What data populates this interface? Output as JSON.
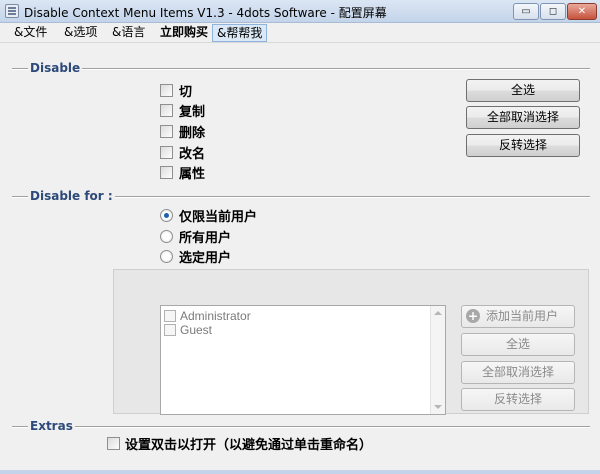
{
  "window": {
    "title": "Disable Context Menu Items V1.3 - 4dots Software - 配置屏幕",
    "minimize": "▭",
    "maximize": "◻",
    "close": "✕"
  },
  "menu": {
    "file": "&文件",
    "options": "&选项",
    "language": "&语言",
    "buy_now": "立即购买",
    "help": "&帮帮我"
  },
  "disable_group": {
    "title": "Disable",
    "items": [
      "切",
      "复制",
      "删除",
      "改名",
      "属性"
    ],
    "checked": [
      false,
      false,
      false,
      false,
      false
    ],
    "select_all": "全选",
    "deselect_all": "全部取消选择",
    "invert": "反转选择"
  },
  "disable_for_group": {
    "title": "Disable for :",
    "options": [
      "仅限当前用户",
      "所有用户",
      "选定用户"
    ],
    "selected_index": 0,
    "users": [
      "Administrator",
      "Guest"
    ],
    "add_current_user": "添加当前用户",
    "select_all": "全选",
    "deselect_all": "全部取消选择",
    "invert": "反转选择"
  },
  "extras_group": {
    "title": "Extras",
    "double_click_option": "设置双击以打开（以避免通过单击重命名）",
    "double_click_checked": false
  }
}
